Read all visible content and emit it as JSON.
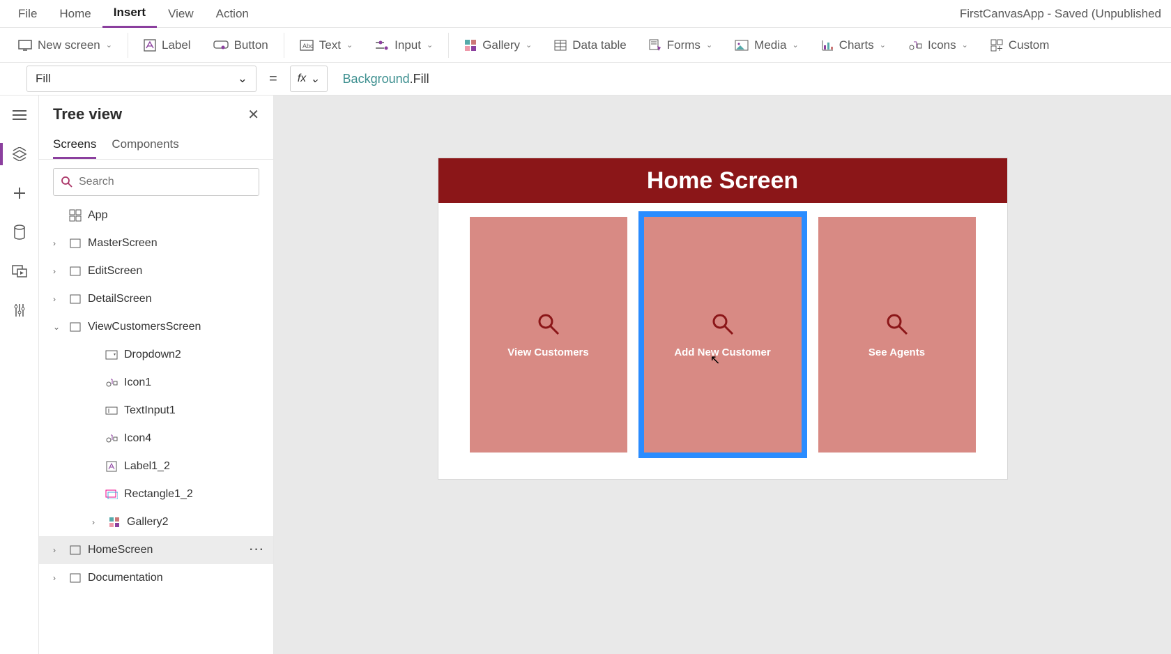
{
  "title_right": "FirstCanvasApp - Saved (Unpublished",
  "menus": {
    "file": "File",
    "home": "Home",
    "insert": "Insert",
    "view": "View",
    "action": "Action"
  },
  "ribbon": {
    "new_screen": "New screen",
    "label": "Label",
    "button": "Button",
    "text": "Text",
    "input": "Input",
    "gallery": "Gallery",
    "data_table": "Data table",
    "forms": "Forms",
    "media": "Media",
    "charts": "Charts",
    "icons": "Icons",
    "custom": "Custom"
  },
  "property_selector": "Fill",
  "formula": {
    "object": "Background",
    "prop": "Fill"
  },
  "tree": {
    "title": "Tree view",
    "tabs": {
      "screens": "Screens",
      "components": "Components"
    },
    "search_placeholder": "Search",
    "app": "App",
    "master": "MasterScreen",
    "edit": "EditScreen",
    "detail": "DetailScreen",
    "viewcust": "ViewCustomersScreen",
    "c_dropdown": "Dropdown2",
    "c_icon1": "Icon1",
    "c_textinput": "TextInput1",
    "c_icon4": "Icon4",
    "c_label": "Label1_2",
    "c_rect": "Rectangle1_2",
    "c_gallery": "Gallery2",
    "home": "HomeScreen",
    "doc": "Documentation"
  },
  "canvas": {
    "screen_title": "Home Screen",
    "card1": "View Customers",
    "card2": "Add New Customer",
    "card3": "See Agents"
  }
}
